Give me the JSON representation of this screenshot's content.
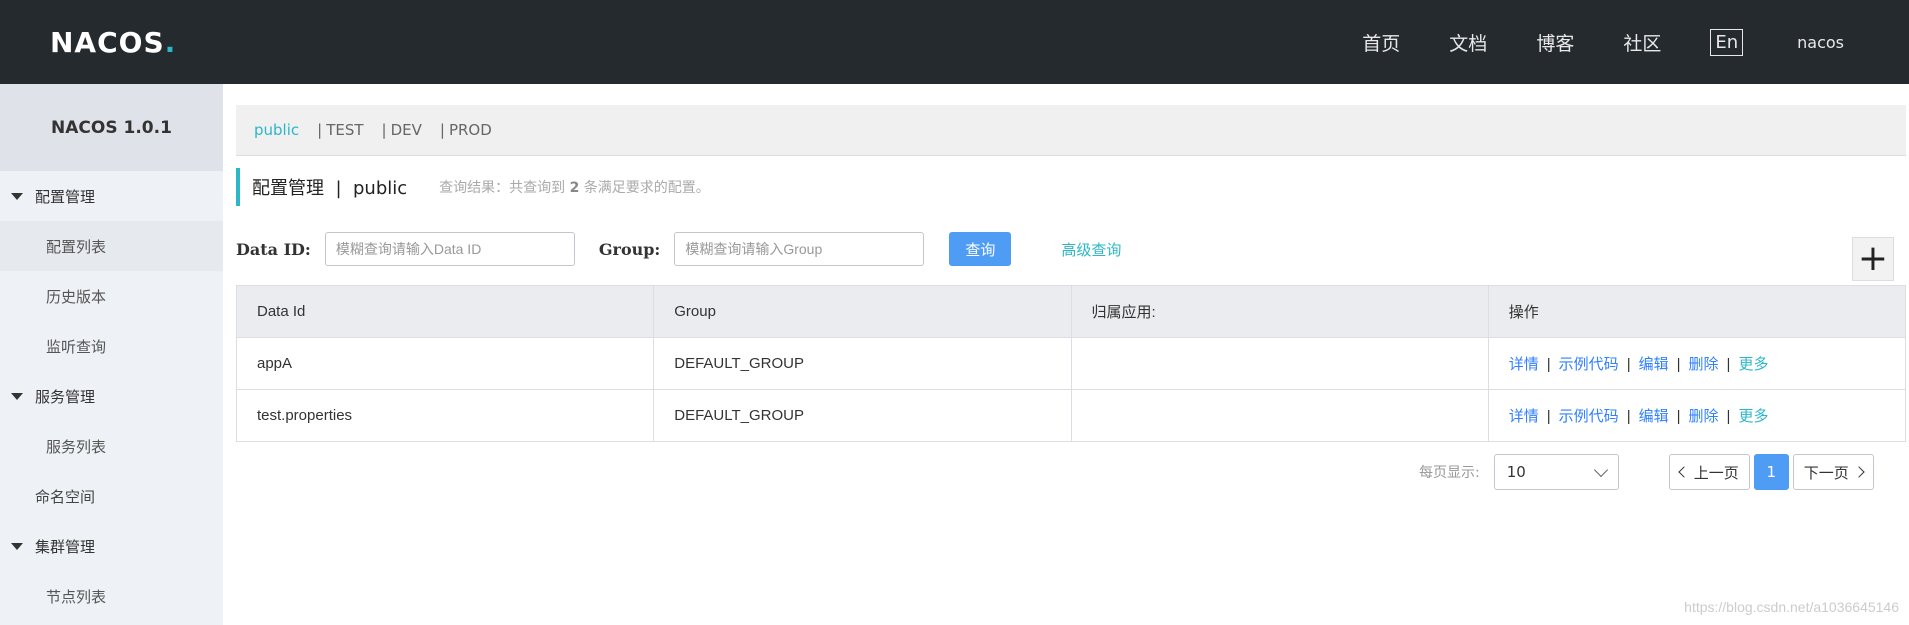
{
  "header": {
    "logo_text": "NACOS",
    "logo_dot": ".",
    "nav": [
      "首页",
      "文档",
      "博客",
      "社区"
    ],
    "lang": "En",
    "user": "nacos"
  },
  "sidebar": {
    "title": "NACOS 1.0.1",
    "groups": [
      {
        "label": "配置管理",
        "items": [
          "配置列表",
          "历史版本",
          "监听查询"
        ]
      },
      {
        "label": "服务管理",
        "items": [
          "服务列表"
        ]
      },
      {
        "label": "命名空间"
      },
      {
        "label": "集群管理",
        "items": [
          "节点列表"
        ]
      }
    ]
  },
  "namespaces": [
    "public",
    "TEST",
    "DEV",
    "PROD"
  ],
  "namespace_sep": "|",
  "title": {
    "name": "配置管理",
    "sep": "|",
    "namespace": "public",
    "result_prefix": "查询结果：共查询到",
    "result_count": "2",
    "result_suffix": "条满足要求的配置。"
  },
  "filters": {
    "dataid_label": "Data ID:",
    "dataid_placeholder": "模糊查询请输入Data ID",
    "group_label": "Group:",
    "group_placeholder": "模糊查询请输入Group",
    "search_label": "查询",
    "advanced_label": "高级查询"
  },
  "add_button": "+",
  "table": {
    "headers": [
      "Data Id",
      "Group",
      "归属应用:",
      "操作"
    ],
    "rows": [
      {
        "data_id": "appA",
        "group": "DEFAULT_GROUP",
        "app": ""
      },
      {
        "data_id": "test.properties",
        "group": "DEFAULT_GROUP",
        "app": ""
      }
    ],
    "ops": [
      "详情",
      "示例代码",
      "编辑",
      "删除",
      "更多"
    ],
    "op_sep": "|"
  },
  "pagination": {
    "per_page_label": "每页显示:",
    "per_page": "10",
    "prev": "上一页",
    "current": "1",
    "next": "下一页"
  },
  "watermark": "https://blog.csdn.net/a1036645146",
  "colors": {
    "header_bg": "#252a2f",
    "accent": "#2cb7c9",
    "primary_button": "#4f9cf5",
    "link": "#3080ff"
  }
}
